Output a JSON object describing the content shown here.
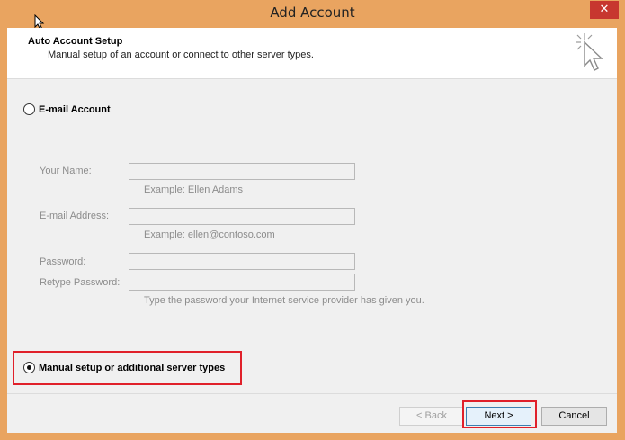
{
  "window": {
    "title": "Add Account",
    "close_label": "✕"
  },
  "header": {
    "title": "Auto Account Setup",
    "subtitle": "Manual setup of an account or connect to other server types."
  },
  "email_option": {
    "label": "E-mail Account",
    "selected": false
  },
  "fields": {
    "name": {
      "label": "Your Name:",
      "value": "",
      "hint": "Example: Ellen Adams"
    },
    "email": {
      "label": "E-mail Address:",
      "value": "",
      "hint": "Example: ellen@contoso.com"
    },
    "password": {
      "label": "Password:",
      "value": ""
    },
    "retype": {
      "label": "Retype Password:",
      "value": "",
      "hint": "Type the password your Internet service provider has given you."
    }
  },
  "manual_option": {
    "label": "Manual setup or additional server types",
    "selected": true
  },
  "buttons": {
    "back": "< Back",
    "next": "Next >",
    "cancel": "Cancel"
  },
  "colors": {
    "frame": "#e9a460",
    "highlight": "#e0202a",
    "close": "#c7372f"
  }
}
